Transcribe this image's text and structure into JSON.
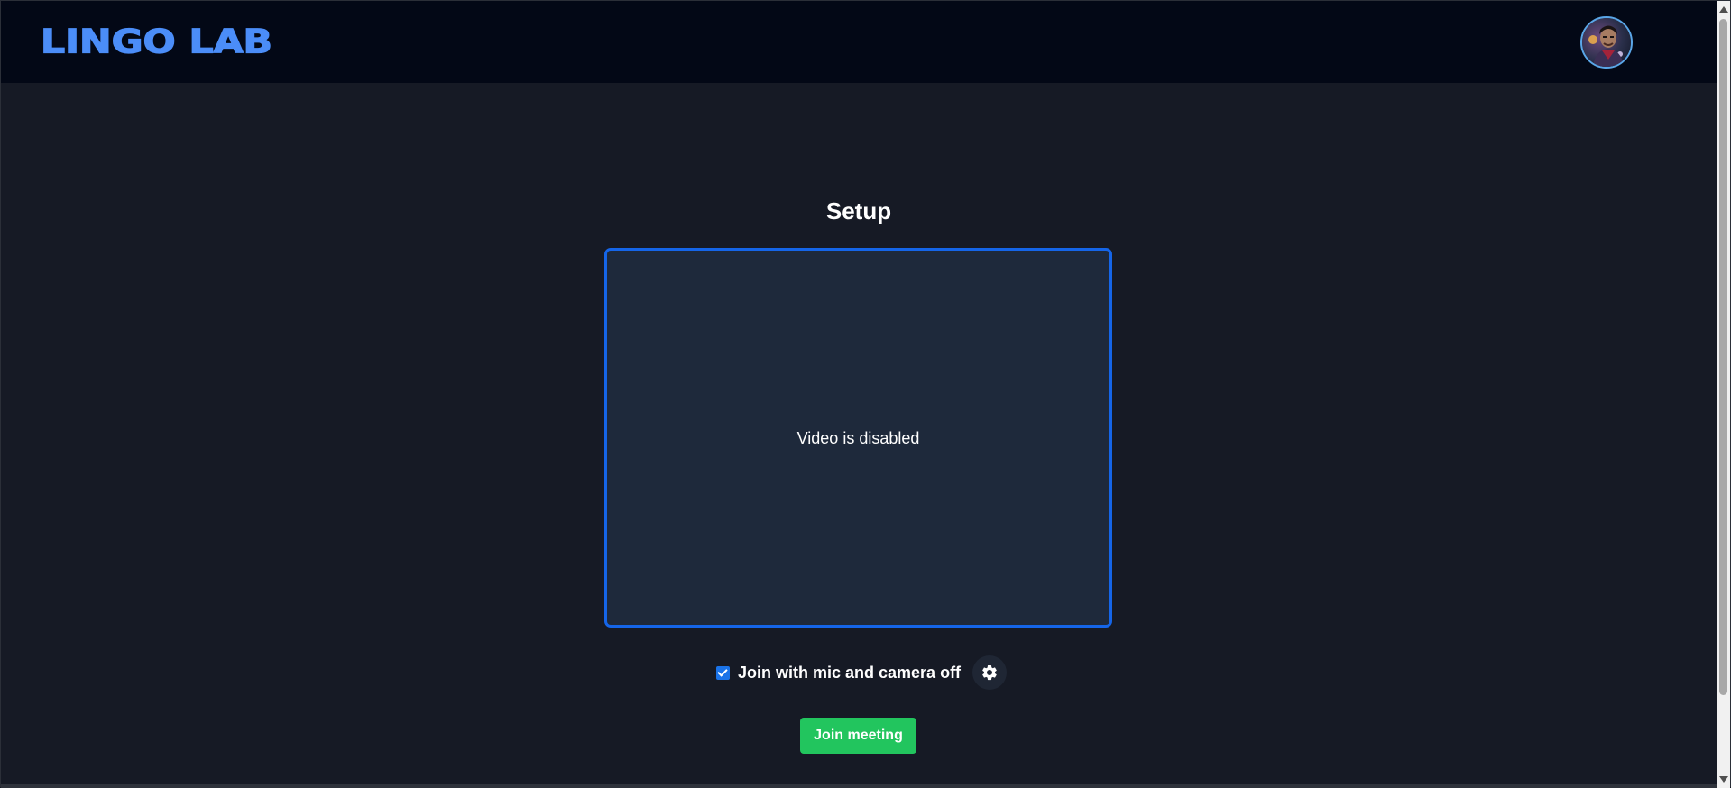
{
  "app": {
    "logo_text": "LINGO LAB"
  },
  "header": {
    "avatar_icon": "user-avatar"
  },
  "setup": {
    "title": "Setup",
    "video_placeholder": "Video is disabled",
    "join_off_label": "Join with mic and camera off",
    "join_off_checked": true,
    "settings_icon": "gear-icon",
    "join_button_label": "Join meeting"
  },
  "colors": {
    "background": "#161a25",
    "topbar": "#030816",
    "accent_blue": "#4b8df8",
    "video_border": "#1565e8",
    "video_bg": "#1e293b",
    "join_button": "#22c55e"
  }
}
